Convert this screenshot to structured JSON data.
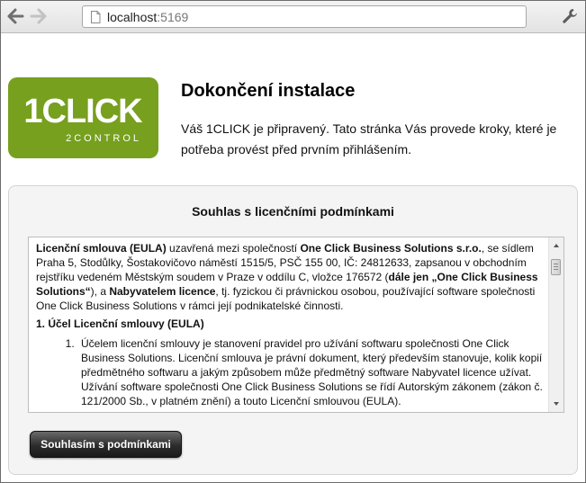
{
  "browser": {
    "url_host": "localhost",
    "url_port": ":5169"
  },
  "logo": {
    "text_main": "1CLICK",
    "text_sub": "2CONTROL",
    "background": "#76a01e"
  },
  "page": {
    "title": "Dokončení instalace",
    "intro": "Váš 1CLICK je připravený. Tato stránka Vás provede kroky, které je potřeba provést před prvním přihlášením."
  },
  "license": {
    "heading": "Souhlas s licenčními podmínkami",
    "intro_parts": [
      {
        "text": "Licenční smlouva (EULA)",
        "bold": true
      },
      {
        "text": " uzavřená mezi společností ",
        "bold": false
      },
      {
        "text": "One Click Business Solutions s.r.o.",
        "bold": true
      },
      {
        "text": ", se sídlem Praha 5, Stodůlky, Šostakovičovo náměstí 1515/5, PSČ 155 00, IČ: 24812633, zapsanou v obchodním rejstříku vedeném Městským soudem v Praze v oddílu C, vložce 176572 (",
        "bold": false
      },
      {
        "text": "dále jen „One Click Business Solutions“",
        "bold": true
      },
      {
        "text": "), a ",
        "bold": false
      },
      {
        "text": "Nabyvatelem licence",
        "bold": true
      },
      {
        "text": ", tj. fyzickou či právnickou osobou, používající software společnosti One Click Business Solutions v rámci její podnikatelské činnosti.",
        "bold": false
      }
    ],
    "section1_title": "1. Účel Licenční smlouvy (EULA)",
    "section1_items": [
      "Účelem licenční smlouvy je stanovení pravidel pro užívání softwaru společnosti One Click Business Solutions. Licenční smlouva je právní dokument, který především stanovuje, kolik kopií předmětného softwaru a jakým způsobem může předmětný software Nabyvatel licence užívat. Užívání software společnosti One Click Business Solutions se řídí Autorským zákonem (zákon č. 121/2000 Sb., v platném znění) a touto Licenční smlouvou (EULA)."
    ],
    "scroll_position": 0.05,
    "agree_button": "Souhlasím s podmínkami"
  }
}
